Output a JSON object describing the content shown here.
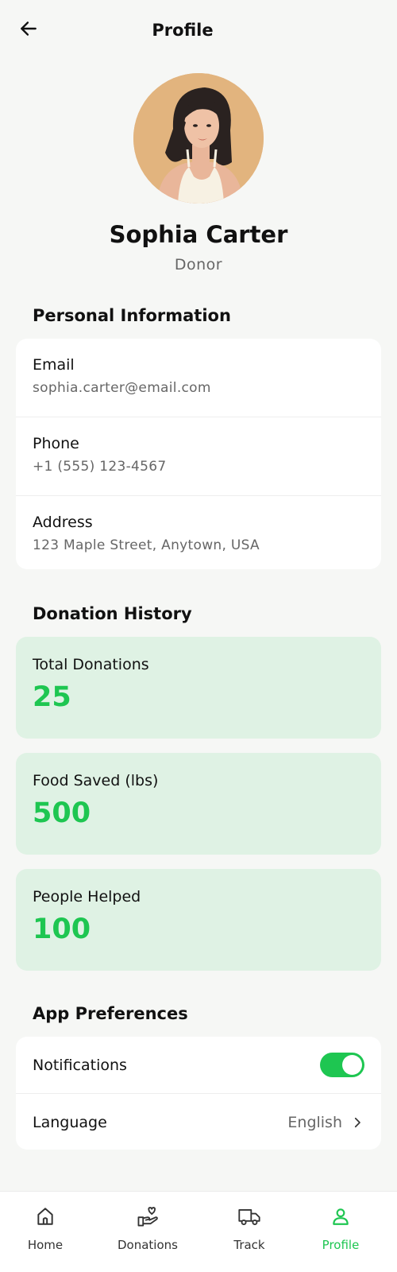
{
  "header": {
    "title": "Profile"
  },
  "profile": {
    "name": "Sophia Carter",
    "role": "Donor"
  },
  "personal_info": {
    "title": "Personal Information",
    "items": [
      {
        "label": "Email",
        "value": "sophia.carter@email.com"
      },
      {
        "label": "Phone",
        "value": "+1 (555) 123-4567"
      },
      {
        "label": "Address",
        "value": "123 Maple Street, Anytown, USA"
      }
    ]
  },
  "donation_history": {
    "title": "Donation History",
    "stats": [
      {
        "label": "Total Donations",
        "value": "25"
      },
      {
        "label": "Food Saved (lbs)",
        "value": "500"
      },
      {
        "label": "People Helped",
        "value": "100"
      }
    ]
  },
  "preferences": {
    "title": "App Preferences",
    "notifications": {
      "label": "Notifications",
      "enabled": true
    },
    "language": {
      "label": "Language",
      "value": "English"
    }
  },
  "nav": {
    "items": [
      {
        "label": "Home",
        "icon": "home-icon",
        "active": false
      },
      {
        "label": "Donations",
        "icon": "donation-hand-heart-icon",
        "active": false
      },
      {
        "label": "Track",
        "icon": "truck-icon",
        "active": false
      },
      {
        "label": "Profile",
        "icon": "person-icon",
        "active": true
      }
    ]
  },
  "colors": {
    "accent": "#1ec651",
    "stat_card_bg": "#dff2e4",
    "page_bg": "#f6f7f5"
  }
}
